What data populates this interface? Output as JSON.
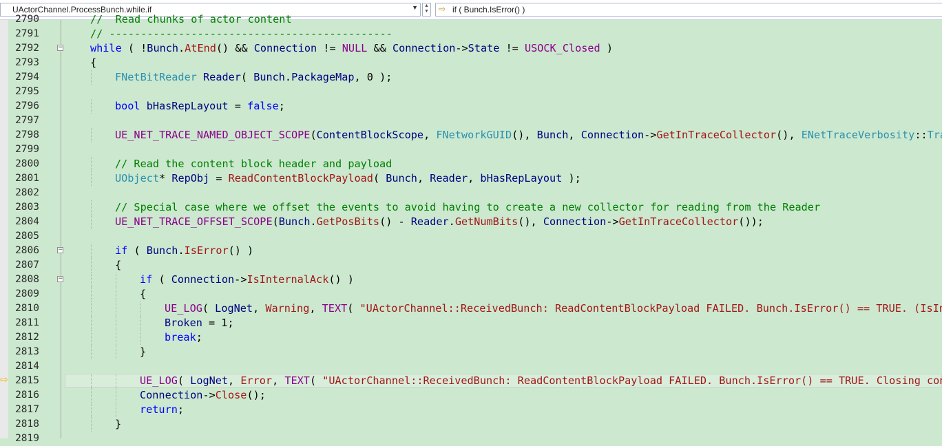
{
  "navigation": {
    "scope_dropdown": "UActorChannel.ProcessBunch.while.if",
    "member_dropdown": "if ( Bunch.IsError() )"
  },
  "editor": {
    "current_line": 2815,
    "line_numbers": [
      "2790",
      "2791",
      "2792",
      "2793",
      "2794",
      "2795",
      "2796",
      "2797",
      "2798",
      "2799",
      "2800",
      "2801",
      "2802",
      "2803",
      "2804",
      "2805",
      "2806",
      "2807",
      "2808",
      "2809",
      "2810",
      "2811",
      "2812",
      "2813",
      "2814",
      "2815",
      "2816",
      "2817",
      "2818",
      "2819"
    ],
    "lines": [
      {
        "indent": 1,
        "parts": [
          [
            "cm",
            "//  Read chunks of actor content"
          ]
        ]
      },
      {
        "indent": 1,
        "parts": [
          [
            "cm",
            "// ---------------------------------------------"
          ]
        ]
      },
      {
        "indent": 1,
        "fold": true,
        "parts": [
          [
            "kw",
            "while"
          ],
          [
            "pu",
            " ( !"
          ],
          [
            "id",
            "Bunch"
          ],
          [
            "pu",
            "."
          ],
          [
            "fn",
            "AtEnd"
          ],
          [
            "pu",
            "() && "
          ],
          [
            "id",
            "Connection"
          ],
          [
            "pu",
            " != "
          ],
          [
            "ma",
            "NULL"
          ],
          [
            "pu",
            " && "
          ],
          [
            "id",
            "Connection"
          ],
          [
            "pu",
            "->"
          ],
          [
            "id",
            "State"
          ],
          [
            "pu",
            " != "
          ],
          [
            "ma",
            "USOCK_Closed"
          ],
          [
            "pu",
            " )"
          ]
        ]
      },
      {
        "indent": 1,
        "parts": [
          [
            "pu",
            "{"
          ]
        ]
      },
      {
        "indent": 2,
        "parts": [
          [
            "ty",
            "FNetBitReader"
          ],
          [
            "pu",
            " "
          ],
          [
            "id",
            "Reader"
          ],
          [
            "pu",
            "( "
          ],
          [
            "id",
            "Bunch"
          ],
          [
            "pu",
            "."
          ],
          [
            "id",
            "PackageMap"
          ],
          [
            "pu",
            ", 0 );"
          ]
        ]
      },
      {
        "indent": 0,
        "parts": []
      },
      {
        "indent": 2,
        "parts": [
          [
            "kw",
            "bool"
          ],
          [
            "pu",
            " "
          ],
          [
            "id",
            "bHasRepLayout"
          ],
          [
            "pu",
            " = "
          ],
          [
            "kw",
            "false"
          ],
          [
            "pu",
            ";"
          ]
        ]
      },
      {
        "indent": 0,
        "parts": []
      },
      {
        "indent": 2,
        "parts": [
          [
            "ma",
            "UE_NET_TRACE_NAMED_OBJECT_SCOPE"
          ],
          [
            "pu",
            "("
          ],
          [
            "id",
            "ContentBlockScope"
          ],
          [
            "pu",
            ", "
          ],
          [
            "ty",
            "FNetworkGUID"
          ],
          [
            "pu",
            "(), "
          ],
          [
            "id",
            "Bunch"
          ],
          [
            "pu",
            ", "
          ],
          [
            "id",
            "Connection"
          ],
          [
            "pu",
            "->"
          ],
          [
            "fn",
            "GetInTraceCollector"
          ],
          [
            "pu",
            "(), "
          ],
          [
            "ty",
            "ENetTraceVerbosity"
          ],
          [
            "pu",
            "::"
          ],
          [
            "ty",
            "Trace"
          ]
        ]
      },
      {
        "indent": 0,
        "parts": []
      },
      {
        "indent": 2,
        "parts": [
          [
            "cm",
            "// Read the content block header and payload"
          ]
        ]
      },
      {
        "indent": 2,
        "parts": [
          [
            "ty",
            "UObject"
          ],
          [
            "pu",
            "* "
          ],
          [
            "id",
            "RepObj"
          ],
          [
            "pu",
            " = "
          ],
          [
            "fn",
            "ReadContentBlockPayload"
          ],
          [
            "pu",
            "( "
          ],
          [
            "id",
            "Bunch"
          ],
          [
            "pu",
            ", "
          ],
          [
            "id",
            "Reader"
          ],
          [
            "pu",
            ", "
          ],
          [
            "id",
            "bHasRepLayout"
          ],
          [
            "pu",
            " );"
          ]
        ]
      },
      {
        "indent": 0,
        "parts": []
      },
      {
        "indent": 2,
        "parts": [
          [
            "cm",
            "// Special case where we offset the events to avoid having to create a new collector for reading from the Reader"
          ]
        ]
      },
      {
        "indent": 2,
        "parts": [
          [
            "ma",
            "UE_NET_TRACE_OFFSET_SCOPE"
          ],
          [
            "pu",
            "("
          ],
          [
            "id",
            "Bunch"
          ],
          [
            "pu",
            "."
          ],
          [
            "fn",
            "GetPosBits"
          ],
          [
            "pu",
            "() - "
          ],
          [
            "id",
            "Reader"
          ],
          [
            "pu",
            "."
          ],
          [
            "fn",
            "GetNumBits"
          ],
          [
            "pu",
            "(), "
          ],
          [
            "id",
            "Connection"
          ],
          [
            "pu",
            "->"
          ],
          [
            "fn",
            "GetInTraceCollector"
          ],
          [
            "pu",
            "());"
          ]
        ]
      },
      {
        "indent": 0,
        "parts": []
      },
      {
        "indent": 2,
        "fold": true,
        "parts": [
          [
            "kw",
            "if"
          ],
          [
            "pu",
            " ( "
          ],
          [
            "id",
            "Bunch"
          ],
          [
            "pu",
            "."
          ],
          [
            "fn",
            "IsError"
          ],
          [
            "pu",
            "() )"
          ]
        ]
      },
      {
        "indent": 2,
        "parts": [
          [
            "pu",
            "{"
          ]
        ]
      },
      {
        "indent": 3,
        "fold": true,
        "parts": [
          [
            "kw",
            "if"
          ],
          [
            "pu",
            " ( "
          ],
          [
            "id",
            "Connection"
          ],
          [
            "pu",
            "->"
          ],
          [
            "fn",
            "IsInternalAck"
          ],
          [
            "pu",
            "() )"
          ]
        ]
      },
      {
        "indent": 3,
        "parts": [
          [
            "pu",
            "{"
          ]
        ]
      },
      {
        "indent": 4,
        "parts": [
          [
            "ma",
            "UE_LOG"
          ],
          [
            "pu",
            "( "
          ],
          [
            "id",
            "LogNet"
          ],
          [
            "pu",
            ", "
          ],
          [
            "fn",
            "Warning"
          ],
          [
            "pu",
            ", "
          ],
          [
            "ma",
            "TEXT"
          ],
          [
            "pu",
            "( "
          ],
          [
            "st",
            "\"UActorChannel::ReceivedBunch: ReadContentBlockPayload FAILED. Bunch.IsError() == TRUE. (IsInte"
          ]
        ]
      },
      {
        "indent": 4,
        "parts": [
          [
            "id",
            "Broken"
          ],
          [
            "pu",
            " = 1;"
          ]
        ]
      },
      {
        "indent": 4,
        "parts": [
          [
            "kw",
            "break"
          ],
          [
            "pu",
            ";"
          ]
        ]
      },
      {
        "indent": 3,
        "parts": [
          [
            "pu",
            "}"
          ]
        ]
      },
      {
        "indent": 0,
        "parts": []
      },
      {
        "indent": 3,
        "current": true,
        "parts": [
          [
            "ma",
            "UE_LOG"
          ],
          [
            "pu",
            "( "
          ],
          [
            "id",
            "LogNet"
          ],
          [
            "pu",
            ", "
          ],
          [
            "fn",
            "Error"
          ],
          [
            "pu",
            ", "
          ],
          [
            "ma",
            "TEXT"
          ],
          [
            "pu",
            "( "
          ],
          [
            "st",
            "\"UActorChannel::ReceivedBunch: ReadContentBlockPayload FAILED. Bunch.IsError() == TRUE. Closing conne"
          ]
        ]
      },
      {
        "indent": 3,
        "parts": [
          [
            "id",
            "Connection"
          ],
          [
            "pu",
            "->"
          ],
          [
            "fn",
            "Close"
          ],
          [
            "pu",
            "();"
          ]
        ]
      },
      {
        "indent": 3,
        "parts": [
          [
            "kw",
            "return"
          ],
          [
            "pu",
            ";"
          ]
        ]
      },
      {
        "indent": 2,
        "parts": [
          [
            "pu",
            "}"
          ]
        ]
      },
      {
        "indent": 0,
        "parts": []
      }
    ]
  },
  "icons": {
    "current_statement": "yellow-arrow-icon",
    "navigate": "orange-arrow-icon",
    "dropdown": "chevron-down-icon"
  },
  "colors": {
    "background": "#cce8cf",
    "keyword": "#0000ff",
    "type": "#2b91af",
    "function": "#a31515",
    "comment": "#008000",
    "macro": "#8b008b",
    "identifier": "#000080"
  }
}
